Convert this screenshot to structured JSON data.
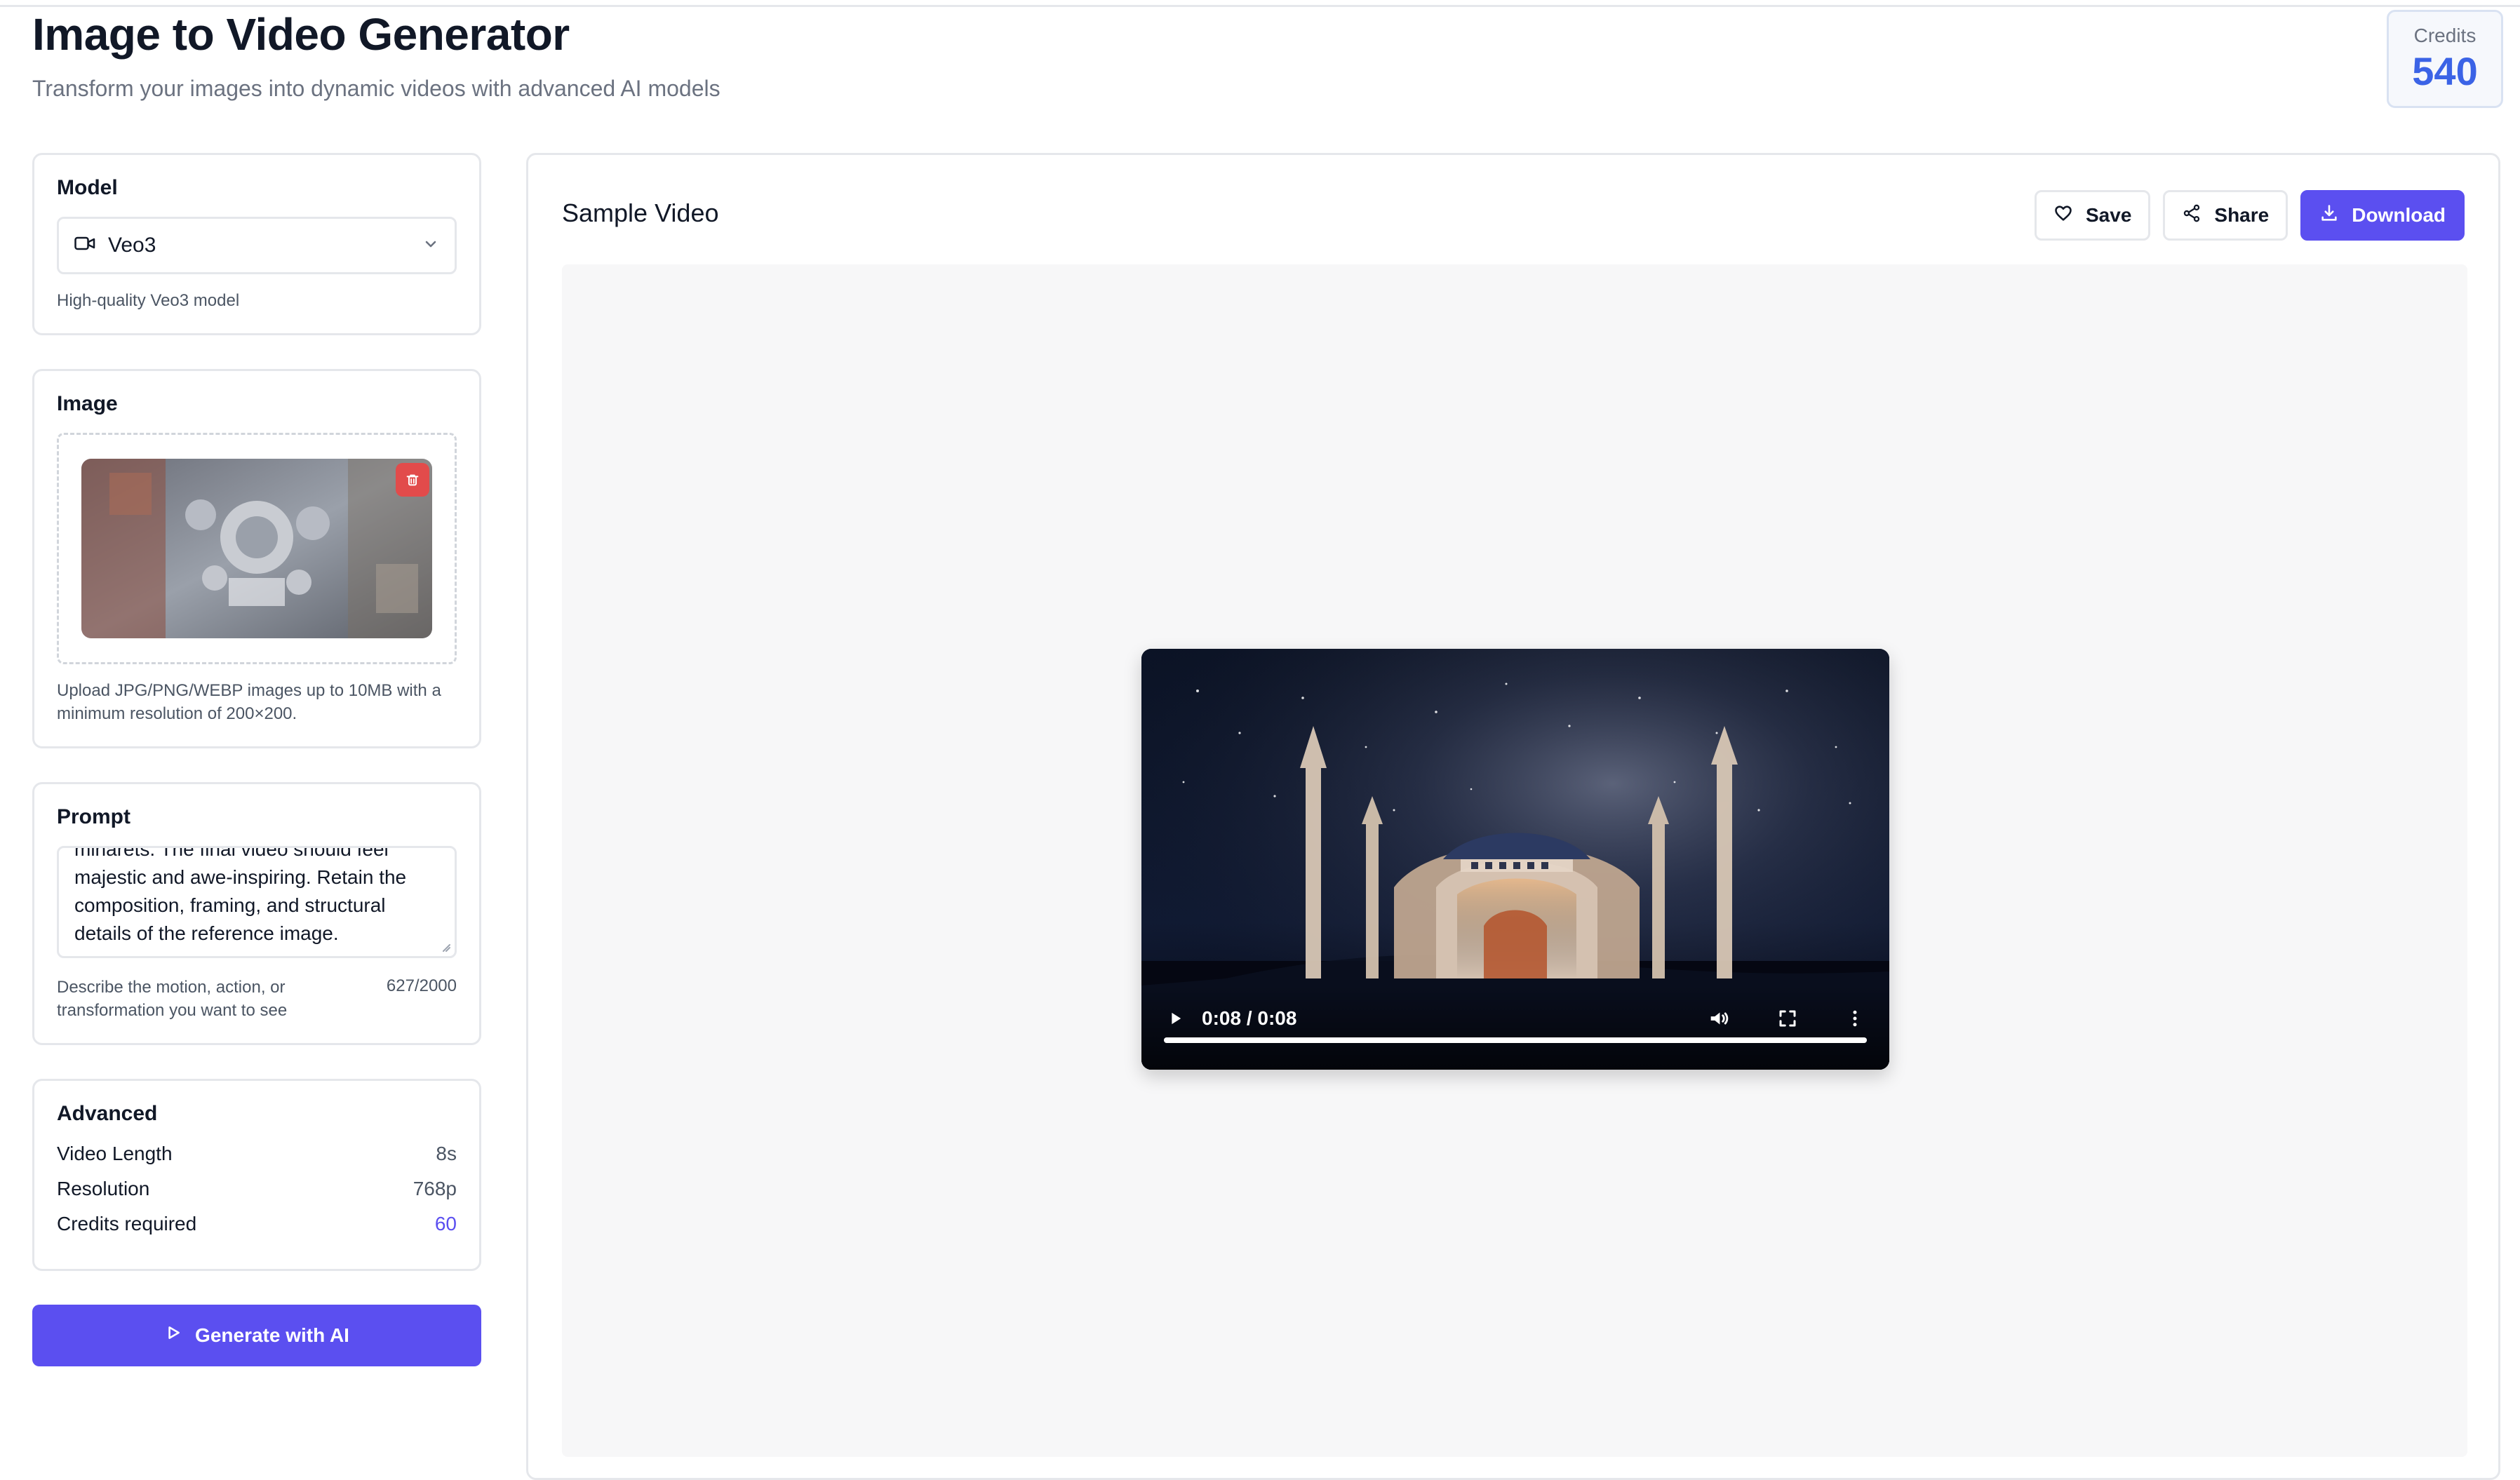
{
  "header": {
    "title": "Image to Video Generator",
    "subtitle": "Transform your images into dynamic videos with advanced AI models"
  },
  "credits": {
    "label": "Credits",
    "value": "540"
  },
  "model": {
    "label": "Model",
    "selected": "Veo3",
    "help": "High-quality Veo3 model",
    "icons": [
      "video-camera-icon",
      "chevron-down-icon"
    ]
  },
  "image": {
    "label": "Image",
    "help": "Upload JPG/PNG/WEBP images up to 10MB with a minimum resolution of 200×200.",
    "icons": [
      "trash-icon"
    ]
  },
  "prompt": {
    "label": "Prompt",
    "text": "minarets. The final video should feel\nmajestic and awe-inspiring. Retain the\ncomposition, framing, and structural\ndetails of the reference image.",
    "help": "Describe the motion, action, or transformation you want to see",
    "count": "627/2000"
  },
  "advanced": {
    "label": "Advanced",
    "rows": [
      {
        "label": "Video Length",
        "value": "8s"
      },
      {
        "label": "Resolution",
        "value": "768p"
      },
      {
        "label": "Credits required",
        "value": "60"
      }
    ]
  },
  "generate": {
    "label": "Generate with AI",
    "icon": "play-outline-icon"
  },
  "main": {
    "title": "Sample Video",
    "actions": {
      "save": "Save",
      "share": "Share",
      "download": "Download"
    }
  },
  "video": {
    "time": "0:08 / 0:08",
    "progress": 1.0
  },
  "colors": {
    "accent": "#5b4ff0",
    "credits": "#3b63e6",
    "delete": "#e24b4b"
  }
}
